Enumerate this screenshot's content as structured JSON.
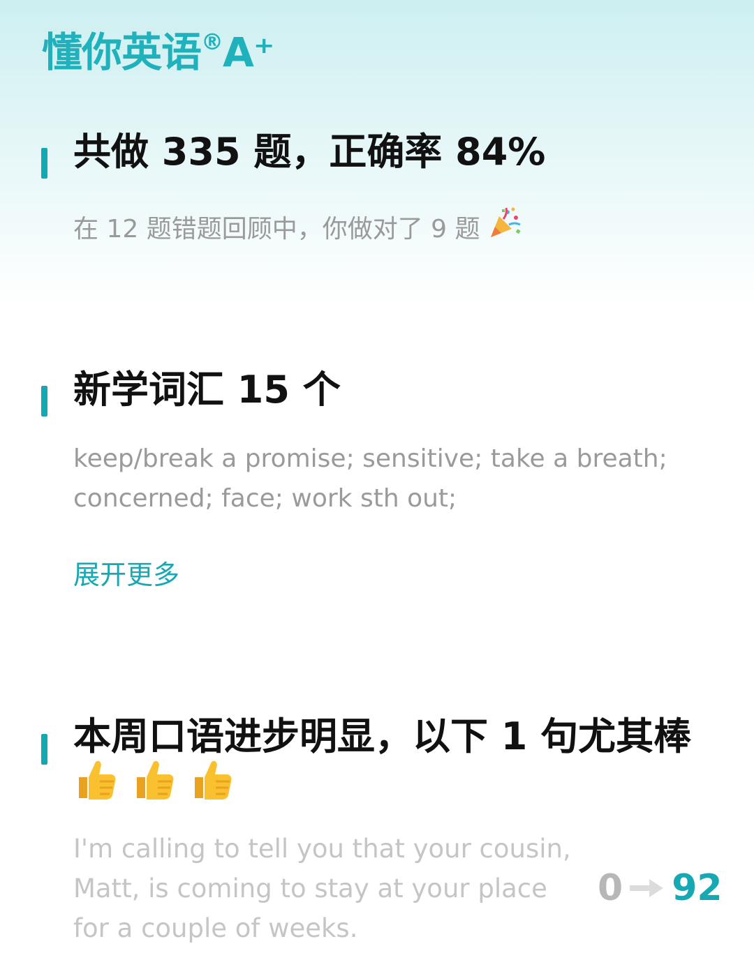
{
  "app": {
    "brand_main": "懂你英语",
    "brand_mark": "®",
    "brand_suffix": "A⁺"
  },
  "summary": {
    "heading": "共做 335 题，正确率 84%",
    "review_text": "在 12 题错题回顾中，你做对了 9 题",
    "celebration_icon": "party-popper-icon"
  },
  "vocabulary": {
    "heading": "新学词汇 15 个",
    "words": "keep/break a promise; sensitive; take a breath; concerned; face; work sth out;",
    "expand_label": "展开更多"
  },
  "speaking": {
    "heading_text": "本周口语进步明显，以下 1 句尤其棒",
    "thumbs_icon": "thumbs-up-icon",
    "thumbs_count": 3,
    "sentence": "I'm calling to tell you that your cousin, Matt, is coming to stay at your place for a couple of weeks.",
    "score_from": "0",
    "score_to": "92"
  },
  "colors": {
    "accent": "#13a9b4",
    "heading": "#111111",
    "muted": "#9a9a9a",
    "faded": "#c5c5c5"
  }
}
